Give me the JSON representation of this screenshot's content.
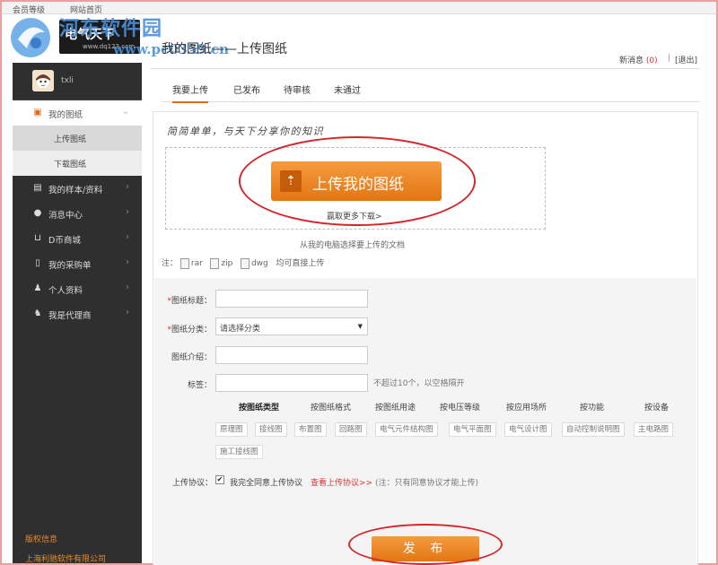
{
  "topbar": {
    "member_level": "会员等级",
    "site_home": "网站首页"
  },
  "watermark": {
    "title": "河东软件园",
    "url": "www.pc0359.cn"
  },
  "brand": {
    "name": "电气天下",
    "url": "www.dq123.com"
  },
  "user": {
    "name": "txli"
  },
  "sidebar": {
    "items": [
      {
        "label": "我的图纸",
        "icon": "picture-icon"
      },
      {
        "label": "我的样本/资料",
        "icon": "book-icon"
      },
      {
        "label": "消息中心",
        "icon": "chat-icon"
      },
      {
        "label": "D币商城",
        "icon": "cart-icon"
      },
      {
        "label": "我的采购单",
        "icon": "document-icon"
      },
      {
        "label": "个人资料",
        "icon": "user-edit-icon"
      },
      {
        "label": "我是代理商",
        "icon": "agent-icon"
      }
    ],
    "sub_items": [
      {
        "label": "上传图纸"
      },
      {
        "label": "下载图纸"
      }
    ],
    "copyright": "版权信息",
    "company": "上海利驰软件有限公司"
  },
  "header": {
    "title": "我的图纸——上传图纸",
    "new_message": "新消息",
    "message_count": "(0)",
    "separator": "|",
    "logout": "[退出]"
  },
  "tabs": [
    "我要上传",
    "已发布",
    "待审核",
    "未通过"
  ],
  "upload": {
    "slogan": "简简单单，与天下分享你的知识",
    "button_label": "上传我的图纸",
    "more_downloads": "赢取更多下载>",
    "from_pc": "从我的电脑选择要上传的文档",
    "note_prefix": "注：",
    "file_types": [
      "rar",
      "zip",
      "dwg"
    ],
    "note_suffix": "均可直接上传"
  },
  "form": {
    "title_label": "图纸标题：",
    "category_label": "图纸分类：",
    "category_value": "请选择分类",
    "intro_label": "图纸介绍：",
    "tags_label": "标签：",
    "tags_hint": "不超过10个，以空格隔开",
    "required_mark": "*",
    "categories": [
      "按图纸类型",
      "按图纸格式",
      "按图纸用途",
      "按电压等级",
      "按应用场所",
      "按功能",
      "按设备"
    ],
    "tags": [
      "原理图",
      "接线图",
      "布置图",
      "回路图",
      "电气元件结构图",
      "电气平面图",
      "电气设计图",
      "自动控制说明图",
      "主电路图",
      "施工接线图"
    ],
    "agreement_label": "上传协议：",
    "agreement_check": "✔",
    "agreement_text": "我完全同意上传协议",
    "agreement_link": "查看上传协议>>",
    "agreement_note": "(注：只有同意协议才能上传)",
    "publish": "发 布"
  },
  "colors": {
    "accent": "#e37612",
    "sidebar_bg": "#2f2f2f",
    "annotation": "#d2262a",
    "watermark": "#4a90d9"
  }
}
